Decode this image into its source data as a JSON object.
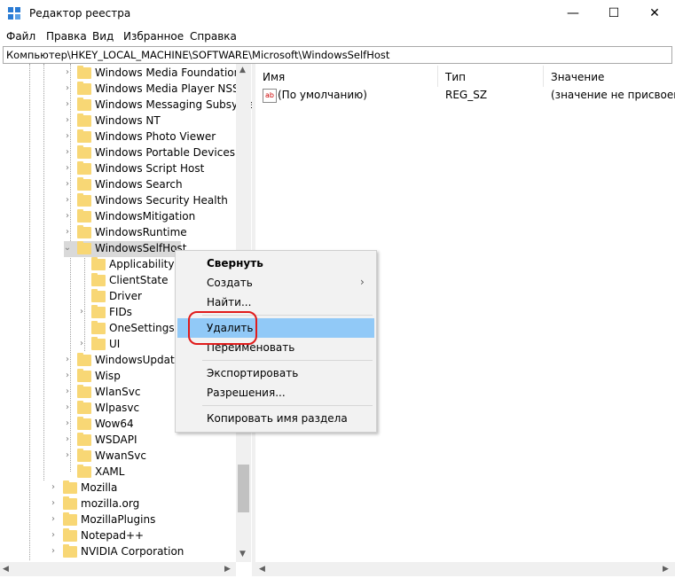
{
  "window": {
    "title": "Редактор реестра",
    "minimize_icon": "minimize-icon",
    "maximize_icon": "maximize-icon",
    "close_icon": "close-icon"
  },
  "menu": [
    "Файл",
    "Правка",
    "Вид",
    "Избранное",
    "Справка"
  ],
  "address": "Компьютер\\HKEY_LOCAL_MACHINE\\SOFTWARE\\Microsoft\\WindowsSelfHost",
  "tree": {
    "items": [
      "Windows Media Foundation",
      "Windows Media Player NSS",
      "Windows Messaging Subsyste",
      "Windows NT",
      "Windows Photo Viewer",
      "Windows Portable Devices",
      "Windows Script Host",
      "Windows Search",
      "Windows Security Health",
      "WindowsMitigation",
      "WindowsRuntime",
      "WindowsSelfHost",
      "Applicability",
      "ClientState",
      "Driver",
      "FIDs",
      "OneSettings",
      "UI",
      "WindowsUpdate",
      "Wisp",
      "WlanSvc",
      "Wlpasvc",
      "Wow64",
      "WSDAPI",
      "WwanSvc",
      "XAML",
      "Mozilla",
      "mozilla.org",
      "MozillaPlugins",
      "Notepad++",
      "NVIDIA Corporation"
    ],
    "selected": "WindowsSelfHost"
  },
  "list": {
    "headers": {
      "name": "Имя",
      "type": "Тип",
      "value": "Значение"
    },
    "rows": [
      {
        "name": "(По умолчанию)",
        "type": "REG_SZ",
        "value": "(значение не присвоено)"
      }
    ]
  },
  "context_menu": {
    "items": [
      "Свернуть",
      "Создать",
      "Найти...",
      "Удалить",
      "Переименовать",
      "Экспортировать",
      "Разрешения...",
      "Копировать имя раздела"
    ],
    "highlighted": "Удалить",
    "highlight_color": "#91c9f7",
    "annotation_color": "#e01b1b"
  }
}
